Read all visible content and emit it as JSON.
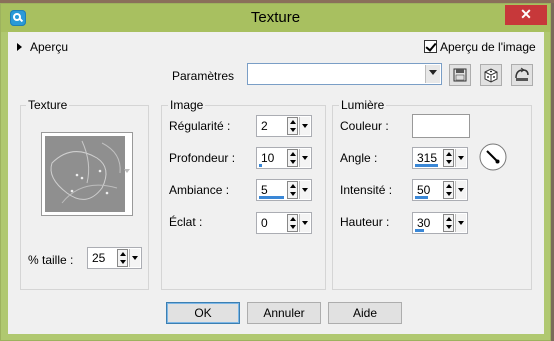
{
  "window": {
    "title": "Texture"
  },
  "preview": {
    "label": "Aperçu",
    "checkbox_label": "Aperçu de l'image",
    "checked": true
  },
  "presets": {
    "label": "Paramètres",
    "value": ""
  },
  "texture": {
    "group_title": "Texture",
    "size_label": "% taille :",
    "size_value": "25"
  },
  "image": {
    "group_title": "Image",
    "fields": [
      {
        "label": "Régularité :",
        "value": "2",
        "level": 0
      },
      {
        "label": "Profondeur :",
        "value": "10",
        "level": 0.1
      },
      {
        "label": "Ambiance :",
        "value": "5",
        "level": 0.95
      },
      {
        "label": "Éclat :",
        "value": "0",
        "level": 0
      }
    ]
  },
  "light": {
    "group_title": "Lumière",
    "color_label": "Couleur :",
    "color_value": "#ffffff",
    "angle_label": "Angle :",
    "angle_value": "315",
    "angle_level": 0.87,
    "intensity_label": "Intensité :",
    "intensity_value": "50",
    "intensity_level": 0.5,
    "height_label": "Hauteur :",
    "height_value": "30",
    "height_level": 0.33
  },
  "footer": {
    "ok": "OK",
    "cancel": "Annuler",
    "help": "Aide"
  },
  "colors": {
    "title_bg": "#a8c060",
    "close_bg": "#c7383a",
    "accent": "#3a87d6"
  }
}
